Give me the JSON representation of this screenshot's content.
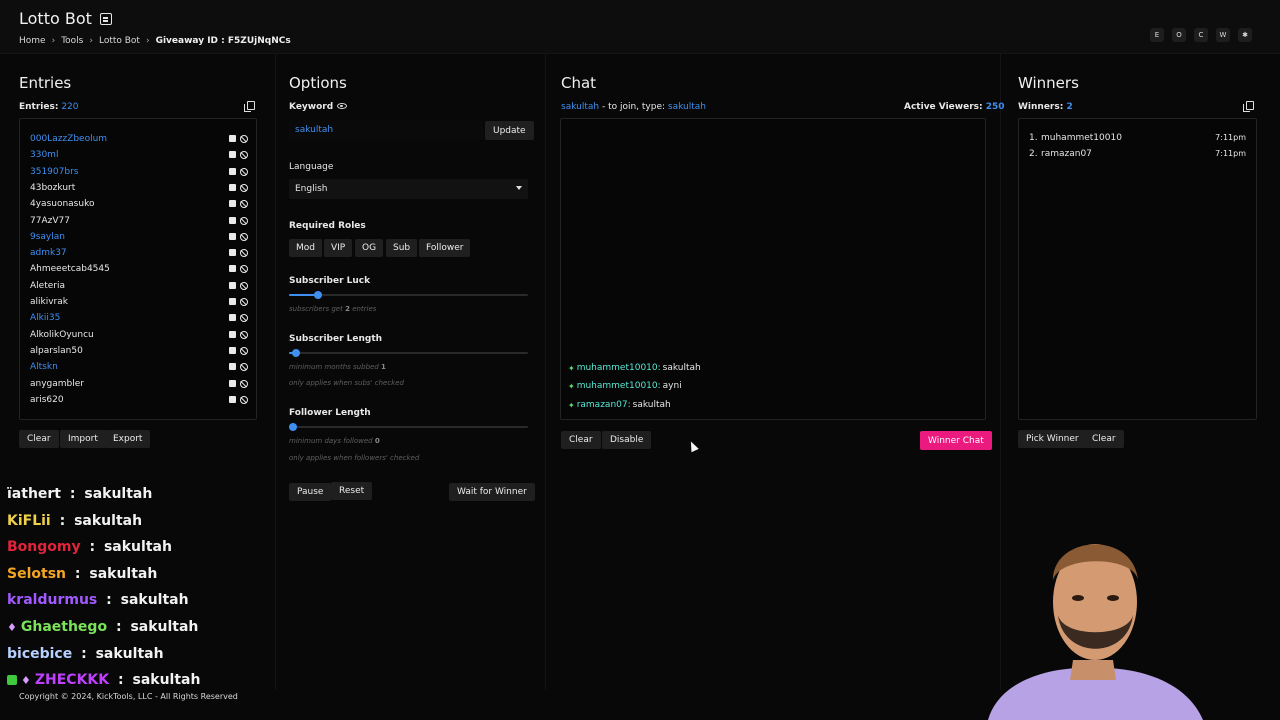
{
  "app": {
    "title": "Lotto Bot"
  },
  "breadcrumb": {
    "home": "Home",
    "tools": "Tools",
    "lotto": "Lotto Bot",
    "current": "Giveaway ID : F5ZUjNqNCs"
  },
  "top_chips": [
    "E",
    "O",
    "C",
    "W",
    "✱"
  ],
  "entries": {
    "title": "Entries",
    "count_label": "Entries:",
    "count": "220",
    "list": [
      {
        "name": "000LazzZbeolum",
        "color": "#3f8ff0"
      },
      {
        "name": "330ml",
        "color": "#3f8ff0"
      },
      {
        "name": "351907brs",
        "color": "#3f8ff0"
      },
      {
        "name": "43bozkurt",
        "color": "#e8e8e8"
      },
      {
        "name": "4yasuonasuko",
        "color": "#e8e8e8"
      },
      {
        "name": "77AzV77",
        "color": "#e8e8e8"
      },
      {
        "name": "9saylan",
        "color": "#3f8ff0"
      },
      {
        "name": "admk37",
        "color": "#3f8ff0"
      },
      {
        "name": "Ahmeeetcab4545",
        "color": "#e8e8e8"
      },
      {
        "name": "Aleteria",
        "color": "#e8e8e8"
      },
      {
        "name": "alikivrak",
        "color": "#e8e8e8"
      },
      {
        "name": "Alkii35",
        "color": "#3f8ff0"
      },
      {
        "name": "AlkolikOyuncu",
        "color": "#e8e8e8"
      },
      {
        "name": "alparslan50",
        "color": "#e8e8e8"
      },
      {
        "name": "Altskn",
        "color": "#3f8ff0"
      },
      {
        "name": "anygambler",
        "color": "#e8e8e8"
      },
      {
        "name": "aris620",
        "color": "#e8e8e8"
      }
    ],
    "buttons": {
      "clear": "Clear",
      "import": "Import",
      "export": "Export"
    }
  },
  "options": {
    "title": "Options",
    "keyword_label": "Keyword",
    "keyword_value": "sakultah",
    "update_button": "Update",
    "language_label": "Language",
    "language_value": "English",
    "roles_label": "Required Roles",
    "roles": [
      "Mod",
      "VIP",
      "OG",
      "Sub",
      "Follower"
    ],
    "sub_luck": {
      "label": "Subscriber Luck",
      "level": 0.12,
      "hint_prefix": "subscribers get",
      "hint_value": "2",
      "hint_suffix": "entries"
    },
    "sub_length": {
      "label": "Subscriber Length",
      "level": 0.03,
      "hint_prefix": "minimum months subbed",
      "hint_value": "1",
      "hint_note": "only applies when subs' checked"
    },
    "follower_length": {
      "label": "Follower Length",
      "level": 0.0,
      "hint_prefix": "minimum days followed",
      "hint_value": "0",
      "hint_note": "only applies when followers' checked"
    },
    "buttons": {
      "pause": "Pause",
      "reset": "Reset",
      "wait": "Wait for Winner"
    }
  },
  "chat": {
    "title": "Chat",
    "join_user": "sakultah",
    "join_text": "- to join, type:",
    "join_keyword": "sakultah",
    "viewers_label": "Active Viewers:",
    "viewers": "250",
    "messages": [
      {
        "user": "muhammet10010:",
        "text": "sakultah"
      },
      {
        "user": "muhammet10010:",
        "text": "ayni"
      },
      {
        "user": "ramazan07:",
        "text": "sakultah"
      }
    ],
    "buttons": {
      "clear": "Clear",
      "disable": "Disable",
      "winner_chat": "Winner Chat"
    }
  },
  "winners": {
    "title": "Winners",
    "count_label": "Winners:",
    "count": "2",
    "list": [
      {
        "num": "1.",
        "name": "muhammet10010",
        "time": "7:11pm"
      },
      {
        "num": "2.",
        "name": "ramazan07",
        "time": "7:11pm"
      }
    ],
    "buttons": {
      "pick": "Pick Winner",
      "clear": "Clear"
    }
  },
  "overlay_chat": [
    {
      "user": "ïathert",
      "sep": " : ",
      "text": "sakultah",
      "color": "#f2f2f2",
      "badges": []
    },
    {
      "user": "KiFLii",
      "sep": " : ",
      "text": "sakultah",
      "color": "#f0d24a",
      "badges": []
    },
    {
      "user": "Bongomy",
      "sep": " : ",
      "text": "sakultah",
      "color": "#e0243a",
      "badges": []
    },
    {
      "user": "Selotsn",
      "sep": " : ",
      "text": "sakultah",
      "color": "#f5a623",
      "badges": []
    },
    {
      "user": "kraldurmus",
      "sep": " : ",
      "text": "sakultah",
      "color": "#a259ff",
      "badges": []
    },
    {
      "user": "Ghaethego",
      "sep": " : ",
      "text": "sakultah",
      "color": "#7be35a",
      "badges": [
        "gem"
      ]
    },
    {
      "user": "bicebice",
      "sep": " : ",
      "text": "sakultah",
      "color": "#b8d0ff",
      "badges": []
    },
    {
      "user": "ZHECKKK",
      "sep": " : ",
      "text": "sakultah",
      "color": "#c040ff",
      "badges": [
        "cube",
        "gem"
      ]
    }
  ],
  "footer": "Copyright © 2024, KickTools, LLC - All Rights Reserved"
}
